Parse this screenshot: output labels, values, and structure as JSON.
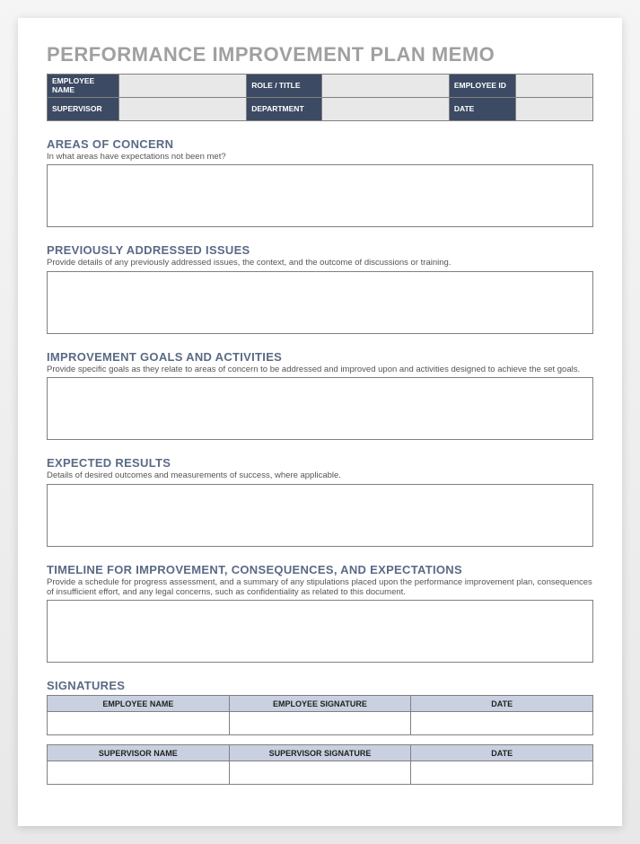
{
  "title": "PERFORMANCE IMPROVEMENT PLAN MEMO",
  "header": {
    "row1": {
      "col1_label": "EMPLOYEE NAME",
      "col1_value": "",
      "col2_label": "ROLE / TITLE",
      "col2_value": "",
      "col3_label": "EMPLOYEE ID",
      "col3_value": ""
    },
    "row2": {
      "col1_label": "SUPERVISOR",
      "col1_value": "",
      "col2_label": "DEPARTMENT",
      "col2_value": "",
      "col3_label": "DATE",
      "col3_value": ""
    }
  },
  "sections": {
    "areas": {
      "title": "AREAS OF CONCERN",
      "desc": "In what areas have expectations not been met?",
      "value": ""
    },
    "previous": {
      "title": "PREVIOUSLY ADDRESSED ISSUES",
      "desc": "Provide details of any previously addressed issues, the context, and the outcome of discussions or training.",
      "value": ""
    },
    "goals": {
      "title": "IMPROVEMENT GOALS AND ACTIVITIES",
      "desc": "Provide specific goals as they relate to areas of concern to be addressed and improved upon and activities designed to achieve the set goals.",
      "value": ""
    },
    "results": {
      "title": "EXPECTED RESULTS",
      "desc": "Details of desired outcomes and measurements of success, where applicable.",
      "value": ""
    },
    "timeline": {
      "title": "TIMELINE FOR IMPROVEMENT, CONSEQUENCES, AND EXPECTATIONS",
      "desc": "Provide a schedule for progress assessment, and a summary of any stipulations placed upon the performance improvement plan, consequences of insufficient effort, and any legal concerns, such as confidentiality as related to this document.",
      "value": ""
    }
  },
  "signatures": {
    "title": "SIGNATURES",
    "employee": {
      "h1": "EMPLOYEE NAME",
      "h2": "EMPLOYEE SIGNATURE",
      "h3": "DATE",
      "v1": "",
      "v2": "",
      "v3": ""
    },
    "supervisor": {
      "h1": "SUPERVISOR NAME",
      "h2": "SUPERVISOR SIGNATURE",
      "h3": "DATE",
      "v1": "",
      "v2": "",
      "v3": ""
    }
  }
}
